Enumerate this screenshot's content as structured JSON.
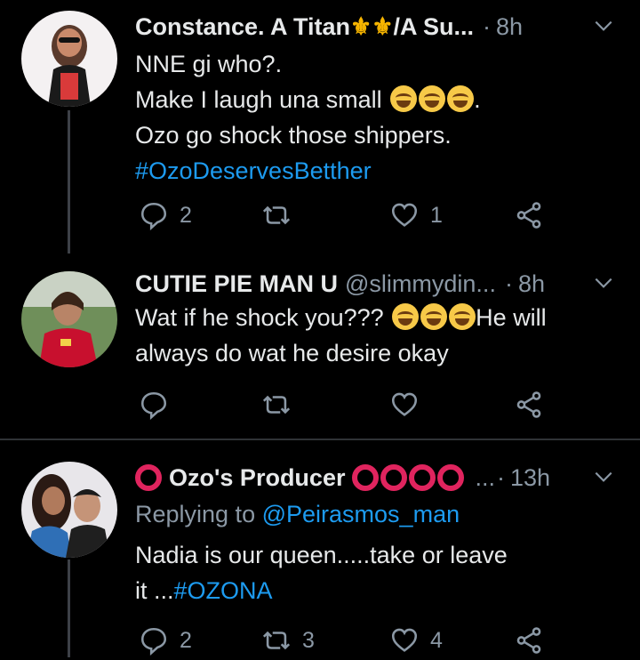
{
  "tweets": [
    {
      "name": "Constance. A Titan",
      "name_suffix": "/A Su...",
      "dot": "·",
      "time": "8h",
      "lines": [
        "NNE gi who?.",
        "Make I laugh una small",
        "Ozo go shock those shippers."
      ],
      "line2_end": ".",
      "hashtag": "#OzoDeservesBetther",
      "reply_count": "2",
      "retweet_count": "",
      "like_count": "1",
      "icons": [
        "reply-icon",
        "retweet-icon",
        "like-icon",
        "share-icon"
      ]
    },
    {
      "name": "CUTIE PIE MAN U",
      "handle": "@slimmydin...",
      "dot": "·",
      "time": "8h",
      "line1_start": "Wat if he shock you???",
      "line1_end": "He will",
      "line2": "always do wat he desire okay",
      "reply_count": "",
      "retweet_count": "",
      "like_count": ""
    },
    {
      "name": "Ozo's Producer",
      "ellipsis": "...",
      "dot": "·",
      "time": "13h",
      "reply_prefix": "Replying to",
      "reply_mention": "@Peirasmos_man",
      "line1": "Nadia is our queen.....take or leave",
      "line2_prefix": "it ...",
      "hashtag": "#OZONA",
      "reply_count": "2",
      "retweet_count": "3",
      "like_count": "4"
    }
  ],
  "colors": {
    "background": "#000000",
    "text": "#e7e9ea",
    "secondary": "#8b98a5",
    "link": "#1d9bf0",
    "divider": "#2f3336",
    "red_ring": "#e0245e"
  }
}
